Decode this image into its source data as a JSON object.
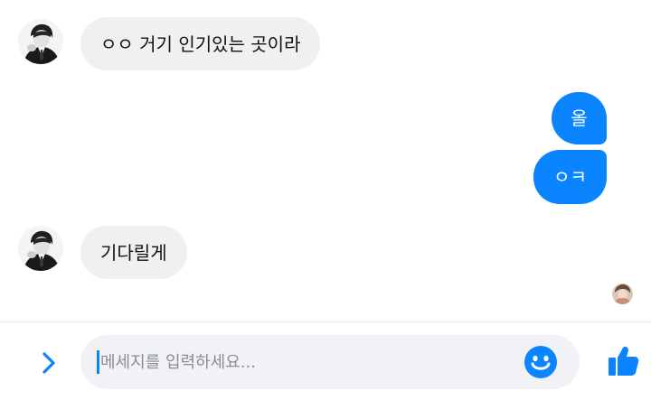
{
  "conversation": {
    "messages": [
      {
        "sender": "them",
        "text": "ㅇㅇ 거기 인기있는 곳이라"
      },
      {
        "sender": "me",
        "text": "올"
      },
      {
        "sender": "me",
        "text": "ㅇㅋ"
      },
      {
        "sender": "them",
        "text": "기다릴게"
      }
    ]
  },
  "composer": {
    "placeholder": "메세지를 입력하세요...",
    "value": ""
  },
  "colors": {
    "accent": "#0a84ff",
    "incoming_bubble": "#f0f0f0",
    "input_background": "#f0f2f5",
    "text": "#111111"
  },
  "icons": {
    "expand": "chevron-right-icon",
    "emoji": "smiley-icon",
    "like": "thumbs-up-icon"
  }
}
